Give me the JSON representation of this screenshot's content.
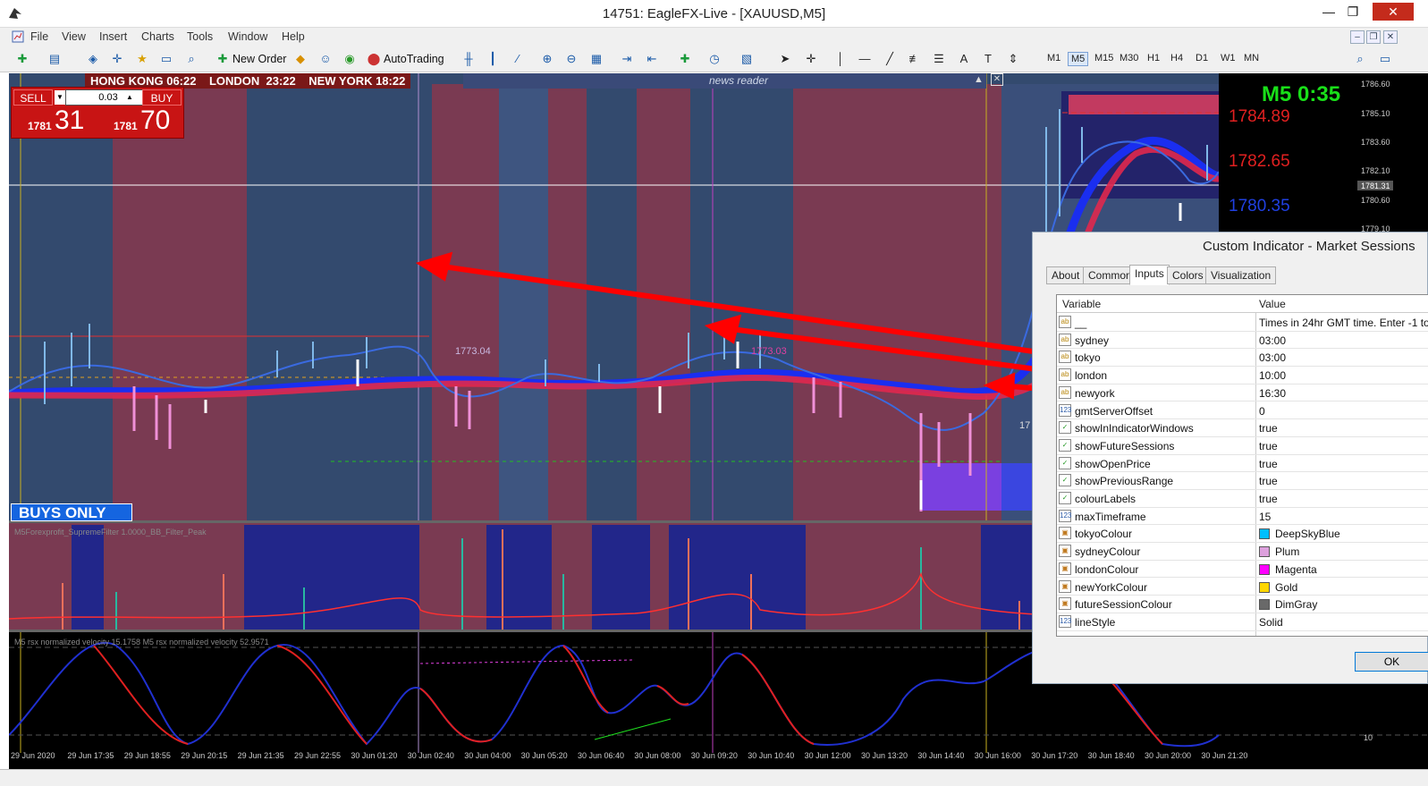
{
  "window": {
    "title": "14751: EagleFX-Live - [XAUUSD,M5]"
  },
  "menu": [
    "File",
    "View",
    "Insert",
    "Charts",
    "Tools",
    "Window",
    "Help"
  ],
  "toolbar": {
    "new_order": "New Order",
    "autotrading": "AutoTrading",
    "timeframes": [
      "M1",
      "M5",
      "M15",
      "M30",
      "H1",
      "H4",
      "D1",
      "W1",
      "MN"
    ],
    "active_timeframe": "M5"
  },
  "sessions_hud": {
    "hong_kong": "HONG KONG 06:22",
    "london": "LONDON  23:22",
    "new_york": "NEW YORK 18:22"
  },
  "news_reader": "news reader",
  "trade_panel": {
    "sell_label": "SELL",
    "buy_label": "BUY",
    "lot": "0.03",
    "sell_small": "1781",
    "sell_big": "31",
    "buy_small": "1781",
    "buy_big": "70"
  },
  "buys_only": "BUYS ONLY",
  "timer": "M5 0:35",
  "price_labels": [
    {
      "text": "1784.89",
      "color": "#e02020"
    },
    {
      "text": "1782.65",
      "color": "#e02020"
    },
    {
      "text": "1780.35",
      "color": "#2040e0"
    }
  ],
  "chart_annotations": {
    "level_label": "1773.04",
    "level_label2": "1773.03",
    "line_label": "17"
  },
  "price_axis": [
    "1786.60",
    "1785.10",
    "1783.60",
    "1782.10",
    "1781.31",
    "1780.60",
    "1779.10"
  ],
  "time_axis": [
    "29 Jun 2020",
    "29 Jun 17:35",
    "29 Jun 18:55",
    "29 Jun 20:15",
    "29 Jun 21:35",
    "29 Jun 22:55",
    "30 Jun 01:20",
    "30 Jun 02:40",
    "30 Jun 04:00",
    "30 Jun 05:20",
    "30 Jun 06:40",
    "30 Jun 08:00",
    "30 Jun 09:20",
    "30 Jun 10:40",
    "30 Jun 12:00",
    "30 Jun 13:20",
    "30 Jun 14:40",
    "30 Jun 16:00",
    "30 Jun 17:20",
    "30 Jun 18:40",
    "30 Jun 20:00",
    "30 Jun 21:20"
  ],
  "indicators": {
    "volume_title": "M5Forexprofit_SupremeFilter 1.0000_BB_Filter_Peak",
    "rsx_title": "M5 rsx normalized velocity 15.1758  M5 rsx normalized velocity 52.9571",
    "rsx_axis": "10"
  },
  "dialog": {
    "title": "Custom Indicator - Market Sessions",
    "tabs": [
      "About",
      "Common",
      "Inputs",
      "Colors",
      "Visualization"
    ],
    "active_tab": "Inputs",
    "headers": {
      "variable": "Variable",
      "value": "Value"
    },
    "rows": [
      {
        "icon": "ab",
        "variable": "__",
        "value": "Times in 24hr GMT time. Enter -1 to"
      },
      {
        "icon": "ab",
        "variable": "sydney",
        "value": "03:00"
      },
      {
        "icon": "ab",
        "variable": "tokyo",
        "value": "03:00"
      },
      {
        "icon": "ab",
        "variable": "london",
        "value": "10:00"
      },
      {
        "icon": "ab",
        "variable": "newyork",
        "value": "16:30"
      },
      {
        "icon": "123",
        "variable": "gmtServerOffset",
        "value": "0"
      },
      {
        "icon": "bool",
        "variable": "showInIndicatorWindows",
        "value": "true"
      },
      {
        "icon": "bool",
        "variable": "showFutureSessions",
        "value": "true"
      },
      {
        "icon": "bool",
        "variable": "showOpenPrice",
        "value": "true"
      },
      {
        "icon": "bool",
        "variable": "showPreviousRange",
        "value": "true"
      },
      {
        "icon": "bool",
        "variable": "colourLabels",
        "value": "true"
      },
      {
        "icon": "123",
        "variable": "maxTimeframe",
        "value": "15"
      },
      {
        "icon": "color",
        "variable": "tokyoColour",
        "value": "DeepSkyBlue",
        "swatch": "#00bfff"
      },
      {
        "icon": "color",
        "variable": "sydneyColour",
        "value": "Plum",
        "swatch": "#dda0dd"
      },
      {
        "icon": "color",
        "variable": "londonColour",
        "value": "Magenta",
        "swatch": "#ff00ff"
      },
      {
        "icon": "color",
        "variable": "newYorkColour",
        "value": "Gold",
        "swatch": "#ffd700"
      },
      {
        "icon": "color",
        "variable": "futureSessionColour",
        "value": "DimGray",
        "swatch": "#696969"
      },
      {
        "icon": "123",
        "variable": "lineStyle",
        "value": "Solid"
      }
    ],
    "ok_label": "OK"
  }
}
